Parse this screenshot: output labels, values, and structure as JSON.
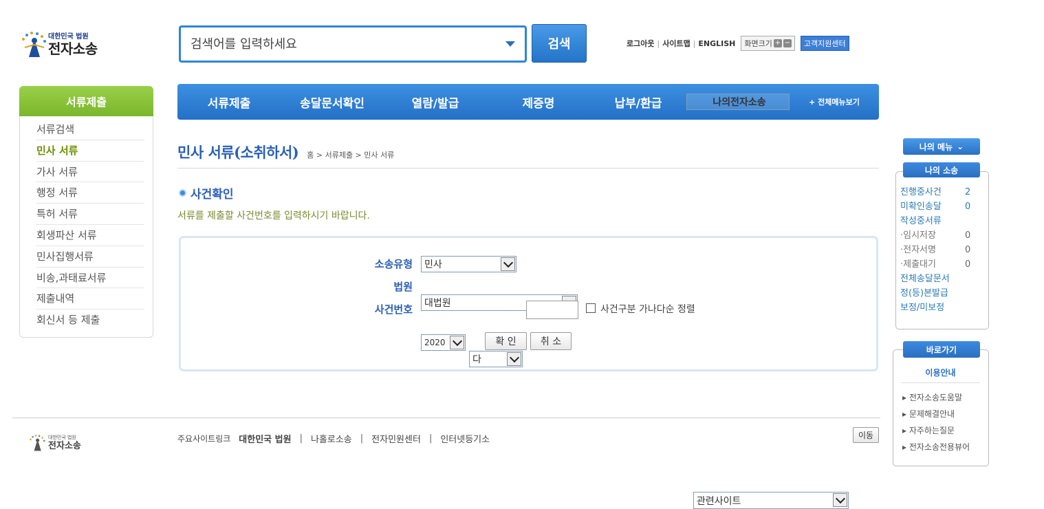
{
  "logo": {
    "line1": "대한민국 법원",
    "line2": "전자소송"
  },
  "search": {
    "placeholder": "검색어를 입력하세요",
    "button": "검색"
  },
  "top_links": {
    "logout": "로그아웃",
    "sitemap": "사이트맵",
    "english": "ENGLISH",
    "fontsize": "화면크기",
    "plus": "+",
    "minus": "−",
    "support": "고객지원센터"
  },
  "side_menu": {
    "title": "서류제출",
    "items": [
      "서류검색",
      "민사 서류",
      "가사 서류",
      "행정 서류",
      "특허 서류",
      "회생파산 서류",
      "민사집행서류",
      "비송,과태료서류",
      "제출내역",
      "회신서 등 제출"
    ],
    "active_index": 1
  },
  "main_nav": {
    "items": [
      "서류제출",
      "송달문서확인",
      "열람/발급",
      "제증명",
      "납부/환급",
      "나의전자소송"
    ],
    "all_menu": "+ 전체메뉴보기"
  },
  "page": {
    "title": "민사 서류(소취하서)",
    "breadcrumb": "홈 > 서류제출 > 민사 서류",
    "section_title": "사건확인",
    "section_desc": "서류를 제출할 사건번호를 입력하시기 바랍니다."
  },
  "form": {
    "label_type": "소송유형",
    "type_value": "민사",
    "label_court": "법원",
    "court_value": "대법원",
    "label_case": "사건번호",
    "year_value": "2020",
    "case_kind_value": "다",
    "case_number_value": "",
    "sort_label": "사건구분 가나다순 정렬",
    "confirm": "확 인",
    "cancel": "취 소"
  },
  "my_menu": {
    "button": "나의 메뉴"
  },
  "my_case": {
    "title": "나의 소송",
    "rows": [
      {
        "label": "진행중사건",
        "value": "2"
      },
      {
        "label": "미확인송달",
        "value": "0"
      },
      {
        "label": "작성중서류",
        "value": ""
      },
      {
        "label": "·임시저장",
        "value": "0"
      },
      {
        "label": "·전자서명",
        "value": "0"
      },
      {
        "label": "·제출대기",
        "value": "0"
      },
      {
        "label": "전체송달문서",
        "value": ""
      },
      {
        "label": "정(등)본발급",
        "value": ""
      },
      {
        "label": "보정/미보정",
        "value": ""
      }
    ]
  },
  "shortcut": {
    "title": "바로가기",
    "guide": "이용안내",
    "links": [
      "전자소송도움말",
      "문제해결안내",
      "자주하는질문",
      "전자소송전용뷰어"
    ]
  },
  "footer": {
    "logo_line1": "대한민국 법원",
    "logo_line2": "전자소송",
    "label": "주요사이트링크",
    "links": [
      "대한민국 법원",
      "나홀로소송",
      "전자민원센터",
      "인터넷등기소"
    ],
    "site_select": "관련사이트",
    "go": "이동"
  }
}
